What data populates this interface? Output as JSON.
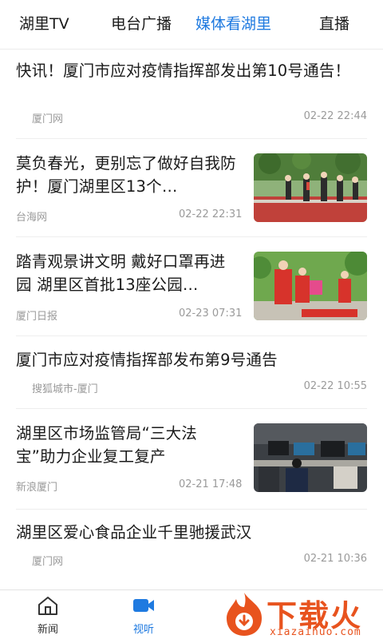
{
  "tabs": [
    {
      "label": "湖里TV"
    },
    {
      "label": "电台广播"
    },
    {
      "label": "媒体看湖里"
    },
    {
      "label": "直播"
    }
  ],
  "active_tab_color": "#1f7ae0",
  "news": [
    {
      "title": "快讯！厦门市应对疫情指挥部发出第10号通告！",
      "source": "厦门网",
      "time": "02-22 22:44"
    },
    {
      "title": "莫负春光，更别忘了做好自我防护！厦门湖里区13个…",
      "source": "台海网",
      "time": "02-22 22:31"
    },
    {
      "title": "踏青观景讲文明 戴好口罩再进园 湖里区首批13座公园…",
      "source": "厦门日报",
      "time": "02-23 07:31"
    },
    {
      "title": "厦门市应对疫情指挥部发布第9号通告",
      "source": "搜狐城市-厦门",
      "time": "02-22 10:55"
    },
    {
      "title": "湖里区市场监管局“三大法宝”助力企业复工复产",
      "source": "新浪厦门",
      "time": "02-21 17:48"
    },
    {
      "title": "湖里区爱心食品企业千里驰援武汉",
      "source": "厦门网",
      "time": "02-21 10:36"
    }
  ],
  "bottom_nav": [
    {
      "label": "新闻",
      "icon": "home-icon"
    },
    {
      "label": "视听",
      "icon": "video-camera-icon"
    }
  ],
  "watermark": {
    "title": "下载火",
    "url": "xiazaihuo.com",
    "color": "#e8531e"
  }
}
